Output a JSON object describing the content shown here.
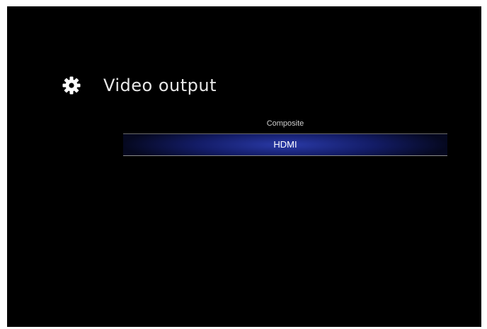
{
  "screen": {
    "title": "Video output",
    "title_icon": "gear-icon",
    "colors": {
      "background": "#000000",
      "selection_accent": "#2a3aa8",
      "text": "#e8e8e8"
    }
  },
  "menu": {
    "items": [
      {
        "label": "Composite",
        "selected": false
      },
      {
        "label": "HDMI",
        "selected": true
      }
    ]
  }
}
